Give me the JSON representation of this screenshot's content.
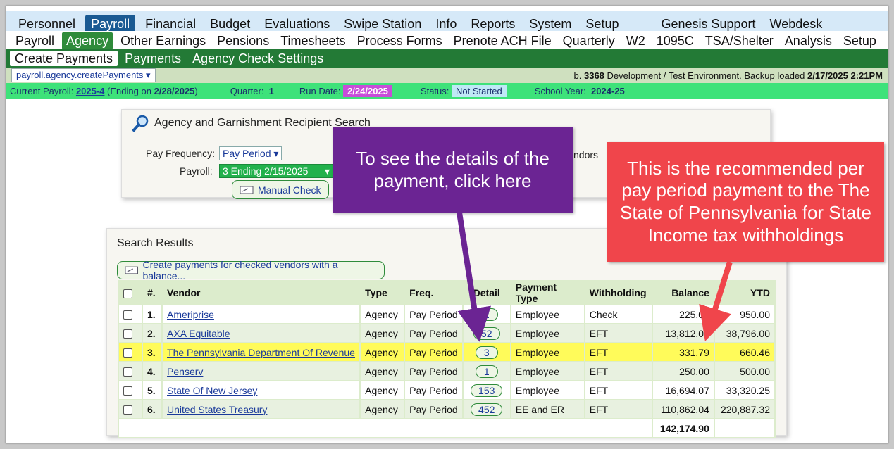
{
  "nav": {
    "main_items": [
      "Personnel",
      "Payroll",
      "Financial",
      "Budget",
      "Evaluations",
      "Swipe Station",
      "Info",
      "Reports",
      "System",
      "Setup"
    ],
    "main_active": "Payroll",
    "right_items": [
      "Genesis Support",
      "Webdesk"
    ],
    "sub_items": [
      "Payroll",
      "Agency",
      "Other Earnings",
      "Pensions",
      "Timesheets",
      "Process Forms",
      "Prenote ACH File",
      "Quarterly",
      "W2",
      "1095C",
      "TSA/Shelter",
      "Analysis",
      "Setup"
    ],
    "sub_active": "Agency",
    "sub2_items": [
      "Create Payments",
      "Payments",
      "Agency Check Settings"
    ],
    "sub2_active": "Create Payments"
  },
  "route": {
    "selector": "payroll.agency.createPayments",
    "build_prefix": "b.",
    "build_number": "3368",
    "env_text": "Development / Test Environment. Backup loaded",
    "backup_date": "2/17/2025 2:21PM"
  },
  "status": {
    "current_payroll_label": "Current Payroll:",
    "current_payroll_value": "2025-4",
    "ending_text": "(Ending on",
    "ending_date": "2/28/2025",
    "ending_close": ")",
    "quarter_label": "Quarter:",
    "quarter_value": "1",
    "run_date_label": "Run Date:",
    "run_date_value": "2/24/2025",
    "status_label": "Status:",
    "status_value": "Not Started",
    "school_year_label": "School Year:",
    "school_year_value": "2024-25"
  },
  "search": {
    "title": "Agency and Garnishment Recipient Search",
    "pay_frequency_label": "Pay Frequency:",
    "pay_frequency_value": "Pay Period",
    "payroll_label": "Payroll:",
    "payroll_value": "3 Ending 2/15/2025",
    "manual_check_label": "Manual Check",
    "vendors_fragment": "ndors"
  },
  "results": {
    "title": "Search Results",
    "create_button": "Create payments for checked vendors with a balance...",
    "columns": [
      "#.",
      "Vendor",
      "Type",
      "Freq.",
      "Detail",
      "Payment Type",
      "Withholding",
      "Balance",
      "YTD"
    ],
    "rows": [
      {
        "num": "1.",
        "vendor": "Ameriprise",
        "type": "Agency",
        "freq": "Pay Period",
        "detail": "2",
        "payment_type": "Employee",
        "withholding": "Check",
        "balance": "225.00",
        "ytd": "950.00"
      },
      {
        "num": "2.",
        "vendor": "AXA Equitable",
        "type": "Agency",
        "freq": "Pay Period",
        "detail": "52",
        "payment_type": "Employee",
        "withholding": "EFT",
        "balance": "13,812.00",
        "ytd": "38,796.00"
      },
      {
        "num": "3.",
        "vendor": "The Pennsylvania Department Of Revenue",
        "type": "Agency",
        "freq": "Pay Period",
        "detail": "3",
        "payment_type": "Employee",
        "withholding": "EFT",
        "balance": "331.79",
        "ytd": "660.46"
      },
      {
        "num": "4.",
        "vendor": "Penserv",
        "type": "Agency",
        "freq": "Pay Period",
        "detail": "1",
        "payment_type": "Employee",
        "withholding": "EFT",
        "balance": "250.00",
        "ytd": "500.00"
      },
      {
        "num": "5.",
        "vendor": "State Of New Jersey",
        "type": "Agency",
        "freq": "Pay Period",
        "detail": "153",
        "payment_type": "Employee",
        "withholding": "EFT",
        "balance": "16,694.07",
        "ytd": "33,320.25"
      },
      {
        "num": "6.",
        "vendor": "United States Treasury",
        "type": "Agency",
        "freq": "Pay Period",
        "detail": "452",
        "payment_type": "EE and ER",
        "withholding": "EFT",
        "balance": "110,862.04",
        "ytd": "220,887.32"
      }
    ],
    "highlighted_row": 2,
    "total_balance": "142,174.90"
  },
  "callouts": {
    "purple": "To see the details of the payment, click here",
    "red": "This is the recommended per pay period payment to the The State of Pennsylvania for State Income tax withholdings"
  },
  "colors": {
    "nav_active": "#1a5a93",
    "agency_green": "#237a36",
    "status_green": "#3ee27a",
    "highlight_yellow": "#fffb5a",
    "callout_purple": "#6b2493",
    "callout_red": "#f0454b"
  }
}
